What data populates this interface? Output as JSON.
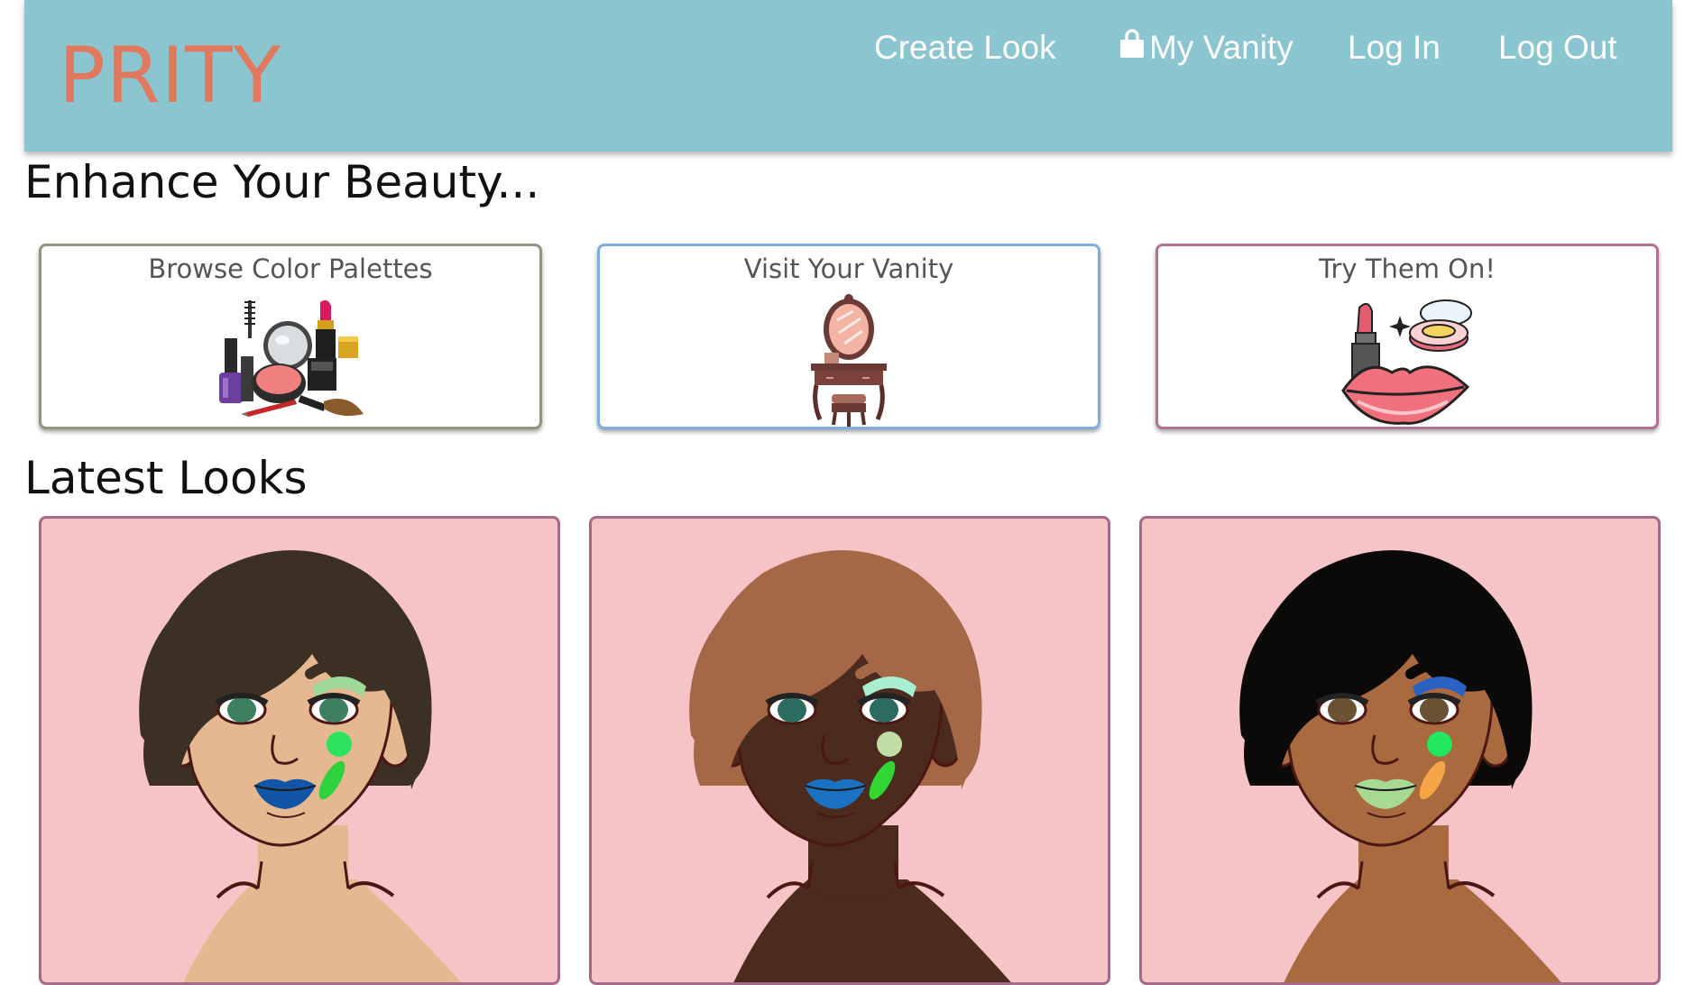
{
  "nav": {
    "brand": "PRITY",
    "links": [
      "Create Look",
      "My Vanity",
      "Log In",
      "Log Out"
    ]
  },
  "headings": {
    "enhance": "Enhance Your Beauty...",
    "latest": "Latest Looks"
  },
  "features": [
    {
      "title": "Browse Color Palettes",
      "icon": "makeup-kit-icon",
      "border": "#8e9680"
    },
    {
      "title": "Visit Your Vanity",
      "icon": "vanity-table-icon",
      "border": "#7eaee0"
    },
    {
      "title": "Try Them On!",
      "icon": "lipstick-lips-icon",
      "border": "#b46f91"
    }
  ],
  "looks": [
    {
      "hair": "#3b3023",
      "skin": "#e6b891",
      "lip": "#1155a6",
      "shadow": "#9fd999",
      "eye": "#3d8060",
      "blush": "#2de35e",
      "contour": "#2fd23d"
    },
    {
      "hair": "#a46846",
      "skin": "#4a2b1e",
      "lip": "#1b72c3",
      "shadow": "#a8efd1",
      "eye": "#2c6b5f",
      "blush": "#c1dca4",
      "contour": "#32d633"
    },
    {
      "hair": "#0c0a08",
      "skin": "#a96a3f",
      "lip": "#a8d992",
      "shadow": "#2a62c4",
      "eye": "#6b5133",
      "blush": "#22e65d",
      "contour": "#f5a545"
    }
  ],
  "colors": {
    "navbar": "#8bc6d0",
    "brand": "#e0795e",
    "card_bg": "#f6c3c6",
    "look_border": "#a36a8a"
  }
}
